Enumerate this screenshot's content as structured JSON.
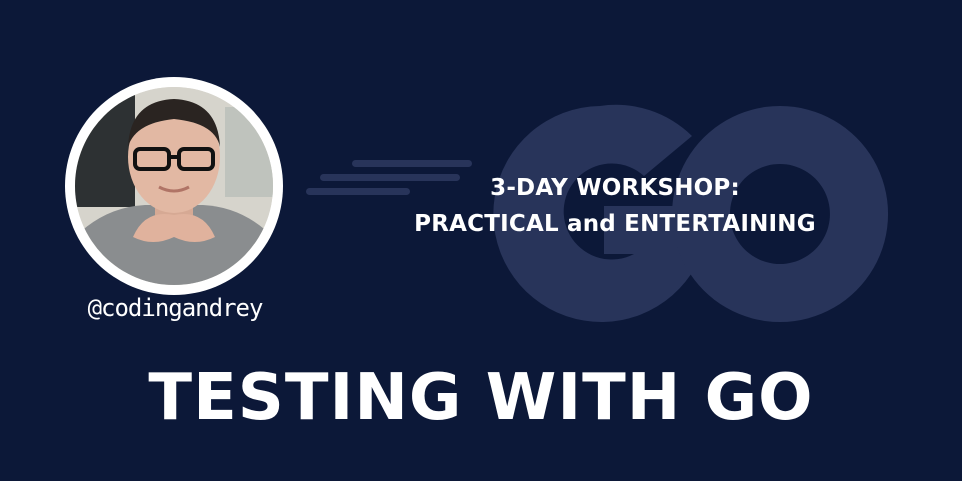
{
  "colors": {
    "background": "#0c1838",
    "logo": "#28345a",
    "text": "#ffffff"
  },
  "go_logo": "go-gopher-wordmark-icon",
  "avatar": "presenter-photo",
  "handle": "@codingandrey",
  "subtitle": {
    "line1": "3-DAY WORKSHOP:",
    "line2": "PRACTICAL and ENTERTAINING"
  },
  "title": "TESTING WITH GO"
}
